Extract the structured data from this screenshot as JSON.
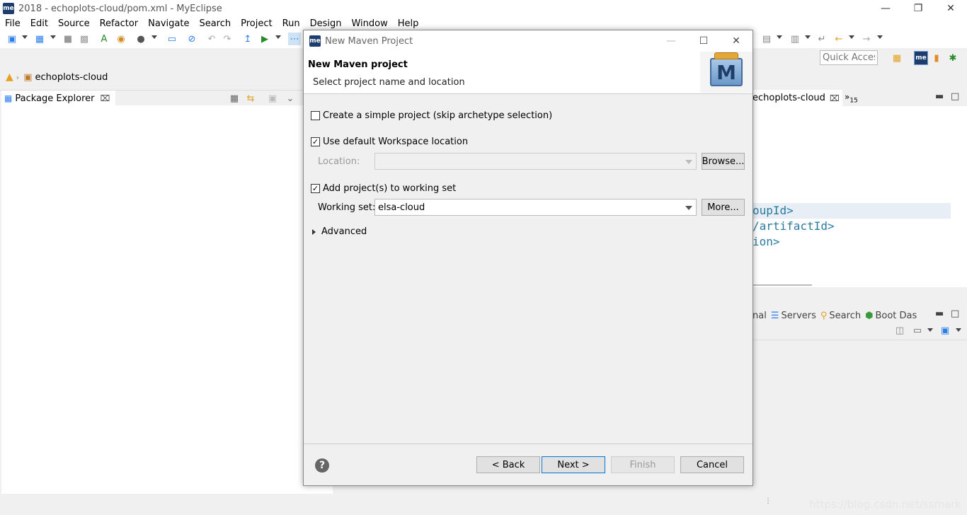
{
  "window": {
    "title": "2018 - echoplots-cloud/pom.xml - MyEclipse",
    "logo_text": "me"
  },
  "menu": [
    "File",
    "Edit",
    "Source",
    "Refactor",
    "Navigate",
    "Search",
    "Project",
    "Run",
    "Design",
    "Window",
    "Help"
  ],
  "quick_access": {
    "placeholder": "Quick Access"
  },
  "breadcrumb": {
    "project": "echoplots-cloud"
  },
  "package_explorer": {
    "title": "Package Explorer"
  },
  "editor": {
    "tab_label": "echoplots-cloud",
    "overflow_count": "15",
    "code_lines": [
      "oupId>",
      "/artifactId>",
      "ion>"
    ]
  },
  "bottom_panel": {
    "tabs": [
      "nal",
      "Servers",
      "Search",
      "Boot Das"
    ]
  },
  "watermark": "https://blog.csdn.net/ssmark",
  "dialog": {
    "title": "New Maven Project",
    "logo_text": "me",
    "header_title": "New Maven project",
    "header_subtitle": "Select project name and location",
    "simple_project": {
      "label": "Create a simple project (skip archetype selection)",
      "checked": false
    },
    "default_location": {
      "label": "Use default Workspace location",
      "checked": true
    },
    "location": {
      "label": "Location:",
      "value": ""
    },
    "browse_label": "Browse...",
    "working_set_checkbox": {
      "label": "Add project(s) to working set",
      "checked": true
    },
    "working_set": {
      "label": "Working set:",
      "value": "elsa-cloud"
    },
    "more_label": "More...",
    "advanced_label": "Advanced",
    "buttons": {
      "back": "< Back",
      "next": "Next >",
      "finish": "Finish",
      "cancel": "Cancel"
    }
  }
}
